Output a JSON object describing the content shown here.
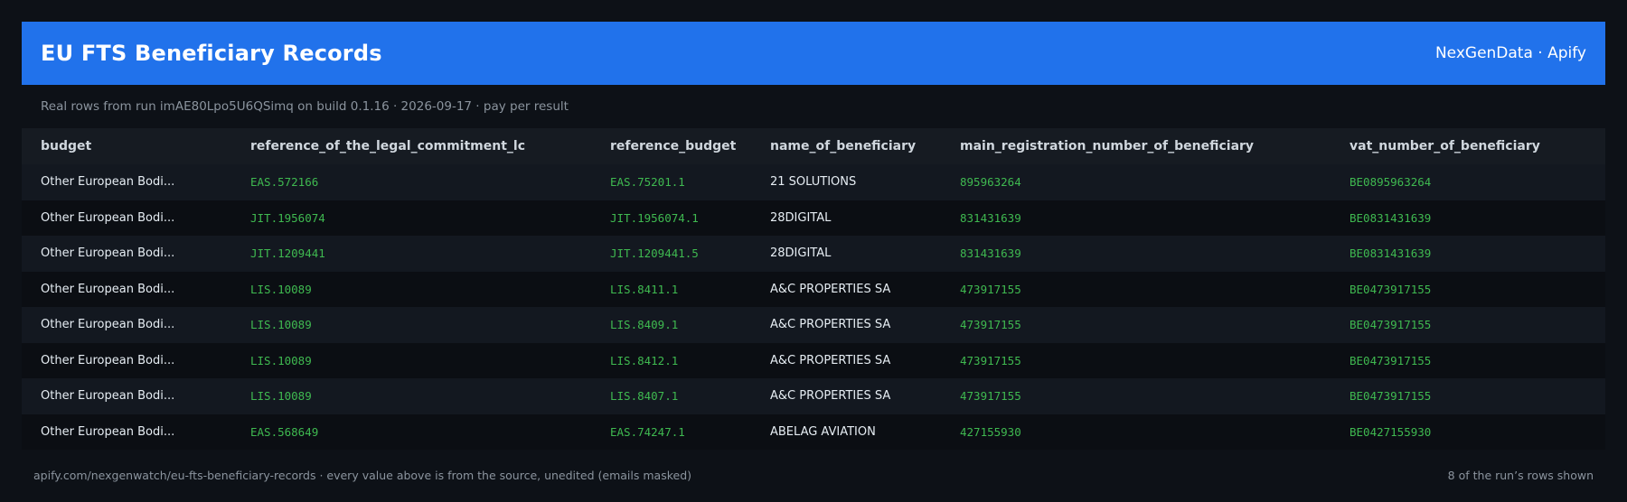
{
  "header": {
    "title": "EU FTS Beneficiary Records",
    "brand": "NexGenData · Apify"
  },
  "subtitle": "Real rows from run imAE80Lpo5U6QSimq on build 0.1.16 · 2026-09-17 · pay per result",
  "table": {
    "columns": [
      "budget",
      "reference_of_the_legal_commitment_lc",
      "reference_budget",
      "name_of_beneficiary",
      "main_registration_number_of_beneficiary",
      "vat_number_of_beneficiary"
    ],
    "rows": [
      [
        "Other European Bodi...",
        "EAS.572166",
        "EAS.75201.1",
        "21 SOLUTIONS",
        "895963264",
        "BE0895963264"
      ],
      [
        "Other European Bodi...",
        "JIT.1956074",
        "JIT.1956074.1",
        "28DIGITAL",
        "831431639",
        "BE0831431639"
      ],
      [
        "Other European Bodi...",
        "JIT.1209441",
        "JIT.1209441.5",
        "28DIGITAL",
        "831431639",
        "BE0831431639"
      ],
      [
        "Other European Bodi...",
        "LIS.10089",
        "LIS.8411.1",
        "A&C PROPERTIES SA",
        "473917155",
        "BE0473917155"
      ],
      [
        "Other European Bodi...",
        "LIS.10089",
        "LIS.8409.1",
        "A&C PROPERTIES SA",
        "473917155",
        "BE0473917155"
      ],
      [
        "Other European Bodi...",
        "LIS.10089",
        "LIS.8412.1",
        "A&C PROPERTIES SA",
        "473917155",
        "BE0473917155"
      ],
      [
        "Other European Bodi...",
        "LIS.10089",
        "LIS.8407.1",
        "A&C PROPERTIES SA",
        "473917155",
        "BE0473917155"
      ],
      [
        "Other European Bodi...",
        "EAS.568649",
        "EAS.74247.1",
        "ABELAG AVIATION",
        "427155930",
        "BE0427155930"
      ]
    ]
  },
  "footer": {
    "source": "apify.com/nexgenwatch/eu-fts-beneficiary-records  ·  every value above is from the source, unedited (emails masked)",
    "count": "8 of the run’s rows shown"
  },
  "colors": {
    "header_bg": "#2172eb",
    "page_bg": "#0d1117",
    "mono_green": "#3fb950"
  }
}
